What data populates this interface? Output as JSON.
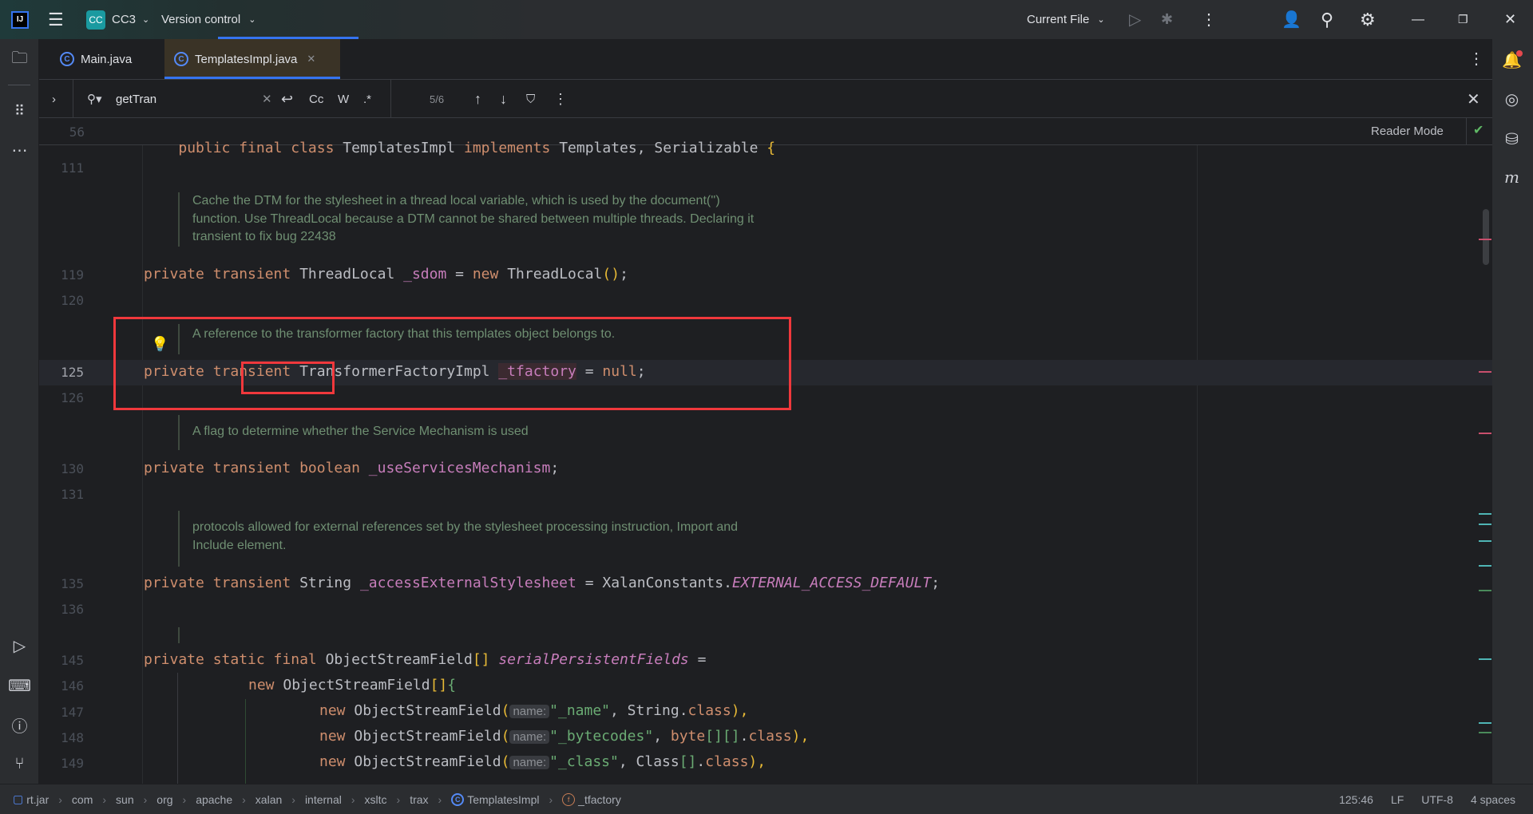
{
  "titlebar": {
    "project_badge": "CC",
    "project": "CC3",
    "vcs": "Version control",
    "run_config": "Current File"
  },
  "tabs": [
    {
      "label": "Main.java"
    },
    {
      "label": "TemplatesImpl.java",
      "active": true
    }
  ],
  "search": {
    "value": "getTran",
    "case_label": "Cc",
    "word_label": "W",
    "regex_label": ".*",
    "count": "5/6"
  },
  "sticky": {
    "line": "56",
    "tokens": [
      "public final class ",
      "TemplatesImpl ",
      "implements ",
      "Templates, Serializable ",
      "{"
    ]
  },
  "reader_mode": "Reader Mode",
  "lines": {
    "l111": "111",
    "l119": "119",
    "l120": "120",
    "l125": "125",
    "l126": "126",
    "l130": "130",
    "l131": "131",
    "l135": "135",
    "l136": "136",
    "l145": "145",
    "l146": "146",
    "l147": "147",
    "l148": "148",
    "l149": "149"
  },
  "docs": {
    "d1": [
      "Cache the DTM for the stylesheet in a thread local variable, which is used by the document('')",
      "function. Use ThreadLocal because a DTM cannot be shared between multiple threads. Declaring it",
      "transient to fix bug 22438"
    ],
    "d2": "A reference to the transformer factory that this templates object belongs to.",
    "d3": "A flag to determine whether the Service Mechanism is used",
    "d4": [
      "protocols allowed for external references set by the stylesheet processing instruction, Import and",
      "Include element."
    ]
  },
  "code": {
    "c119": [
      "private transient ",
      "ThreadLocal ",
      "_sdom",
      " = ",
      "new ",
      "ThreadLocal",
      "()",
      ";"
    ],
    "c125": [
      "private ",
      "transient",
      " TransformerFactoryImpl ",
      "_tfactory",
      " = ",
      "null",
      ";"
    ],
    "c130": [
      "private transient boolean ",
      "_useServicesMechanism",
      ";"
    ],
    "c135": [
      "private transient ",
      "String ",
      "_accessExternalStylesheet",
      " = XalanConstants.",
      "EXTERNAL_ACCESS_DEFAULT",
      ";"
    ],
    "c145": [
      "private static final ",
      "ObjectStreamField",
      "[]",
      " ",
      "serialPersistentFields",
      " ="
    ],
    "c146": [
      "new ",
      "ObjectStreamField",
      "[]",
      "{"
    ],
    "hint": "name:",
    "c147": [
      "new ",
      "ObjectStreamField",
      "(",
      "\"_name\"",
      ", String.",
      "class",
      "),"
    ],
    "c148": [
      "new ",
      "ObjectStreamField",
      "(",
      "\"_bytecodes\"",
      ", ",
      "byte",
      "[][]",
      ".",
      "class",
      "),"
    ],
    "c149": [
      "new ",
      "ObjectStreamField",
      "(",
      "\"_class\"",
      ", Class",
      "[]",
      ".",
      "class",
      "),"
    ]
  },
  "status": {
    "crumbs": [
      "rt.jar",
      "com",
      "sun",
      "org",
      "apache",
      "xalan",
      "internal",
      "xsltc",
      "trax",
      "TemplatesImpl",
      "_tfactory"
    ],
    "position": "125:46",
    "line_sep": "LF",
    "encoding": "UTF-8",
    "indent": "4 spaces"
  },
  "colors": {
    "accent": "#3574f0",
    "highlight_box": "#f0383c",
    "keyword": "#cf8e6d",
    "field": "#c77dbb",
    "string": "#6aab73"
  }
}
